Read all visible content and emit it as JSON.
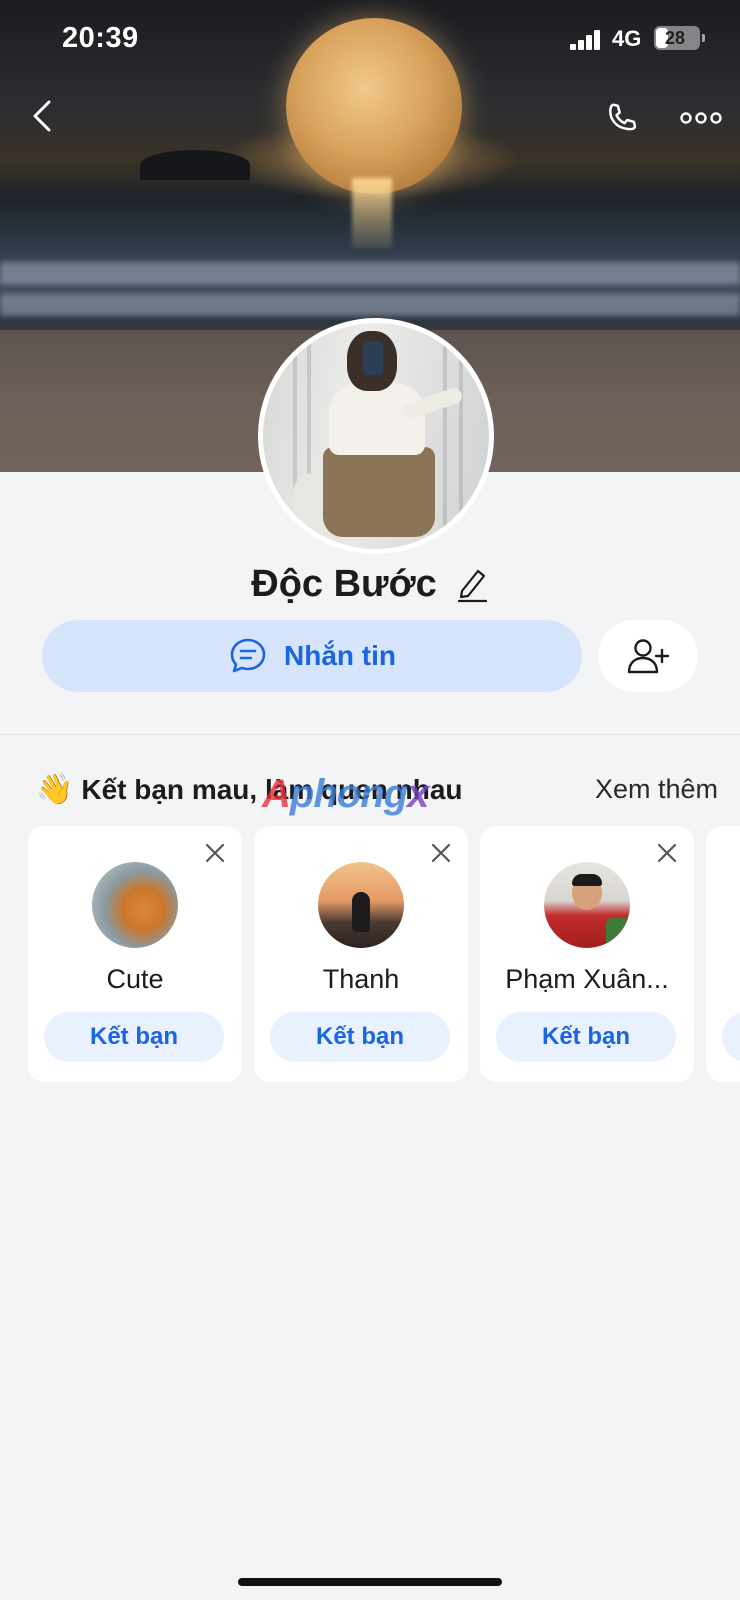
{
  "status_bar": {
    "time": "20:39",
    "network": "4G",
    "battery": "28",
    "battery_level": 0.28
  },
  "profile": {
    "name": "Độc Bước"
  },
  "actions": {
    "message_label": "Nhắn tin"
  },
  "suggestions": {
    "title": "Kết bạn mau, làm quen nhau",
    "see_more": "Xem thêm",
    "watermark": {
      "part1": "A",
      "part2": "phong",
      "part3": "x"
    },
    "cards": [
      {
        "name": "Cute",
        "button": "Kết bạn"
      },
      {
        "name": "Thanh",
        "button": "Kết bạn"
      },
      {
        "name": "Phạm Xuân...",
        "button": "Kết bạn"
      }
    ]
  },
  "colors": {
    "accent": "#1a66e0",
    "accent_bg": "#d6e5fb",
    "page_bg": "#f3f4f6"
  }
}
